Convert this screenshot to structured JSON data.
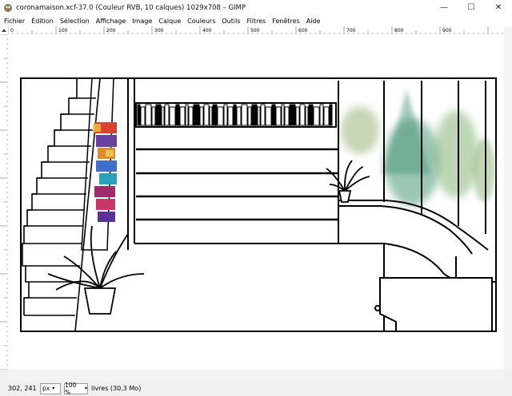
{
  "window": {
    "title": "coronamaison.xcf-37.0 (Couleur RVB, 10 calques) 1029x708 – GIMP",
    "minimize": "—",
    "maximize": "☐",
    "close": "✕"
  },
  "menubar": {
    "items": [
      "Fichier",
      "Édition",
      "Sélection",
      "Affichage",
      "Image",
      "Calque",
      "Couleurs",
      "Outils",
      "Filtres",
      "Fenêtres",
      "Aide"
    ]
  },
  "rulers": {
    "horizontal_labels": [
      "0",
      "100",
      "200",
      "300",
      "400",
      "500",
      "600",
      "700",
      "800",
      "900"
    ]
  },
  "statusbar": {
    "coords": "302, 241",
    "unit": "px",
    "zoom": "100 %",
    "layer_info": "livres (30,3 Mo)"
  },
  "colors": {
    "accent": "#e8631a",
    "background": "#f0f0f0",
    "canvas": "#ffffff"
  }
}
